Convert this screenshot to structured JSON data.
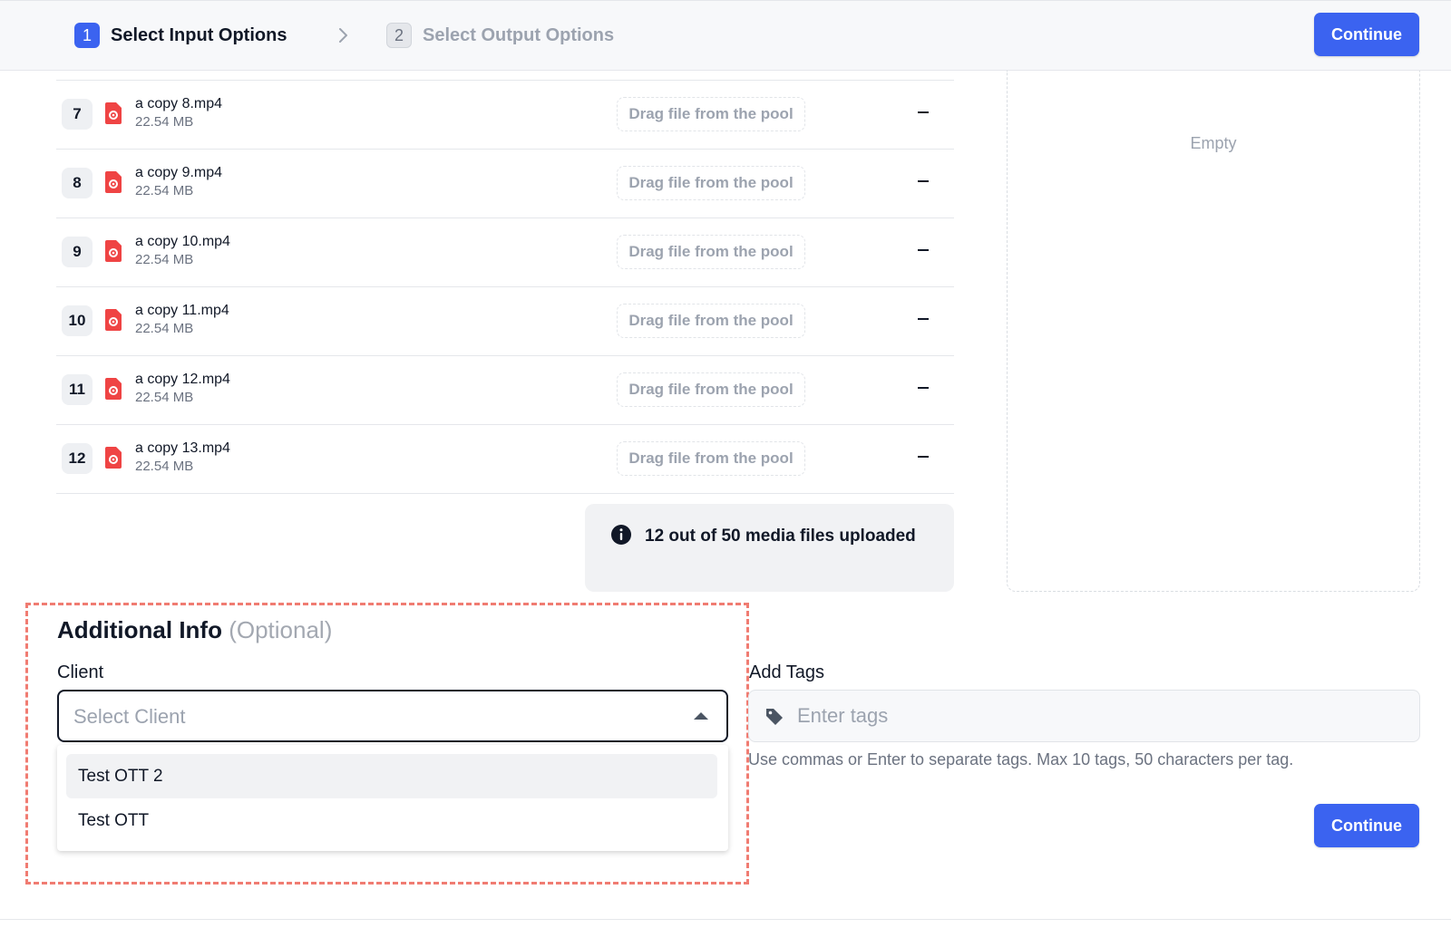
{
  "header": {
    "steps": [
      {
        "number": "1",
        "label": "Select Input Options",
        "state": "active"
      },
      {
        "number": "2",
        "label": "Select Output Options",
        "state": "inactive"
      }
    ],
    "continue_label": "Continue"
  },
  "files": [
    {
      "index": "7",
      "name": "a copy 8.mp4",
      "size": "22.54 MB",
      "drop_label": "Drag file from the pool"
    },
    {
      "index": "8",
      "name": "a copy 9.mp4",
      "size": "22.54 MB",
      "drop_label": "Drag file from the pool"
    },
    {
      "index": "9",
      "name": "a copy 10.mp4",
      "size": "22.54 MB",
      "drop_label": "Drag file from the pool"
    },
    {
      "index": "10",
      "name": "a copy 11.mp4",
      "size": "22.54 MB",
      "drop_label": "Drag file from the pool"
    },
    {
      "index": "11",
      "name": "a copy 12.mp4",
      "size": "22.54 MB",
      "drop_label": "Drag file from the pool"
    },
    {
      "index": "12",
      "name": "a copy 13.mp4",
      "size": "22.54 MB",
      "drop_label": "Drag file from the pool"
    }
  ],
  "info": {
    "text": "12 out of 50 media files uploaded"
  },
  "pool": {
    "empty_text": "Empty"
  },
  "additional_info": {
    "title": "Additional Info",
    "optional": "(Optional)",
    "client_label": "Client",
    "client_placeholder": "Select Client",
    "client_options": [
      "Test OTT 2",
      "Test OTT"
    ],
    "tags_label": "Add Tags",
    "tags_placeholder": "Enter tags",
    "tags_helper": "Use commas or Enter to separate tags. Max 10 tags, 50 characters per tag."
  },
  "footer": {
    "continue_label": "Continue"
  },
  "colors": {
    "accent": "#3b63f0",
    "file_icon": "#ef4444",
    "highlight": "#f07c72"
  }
}
